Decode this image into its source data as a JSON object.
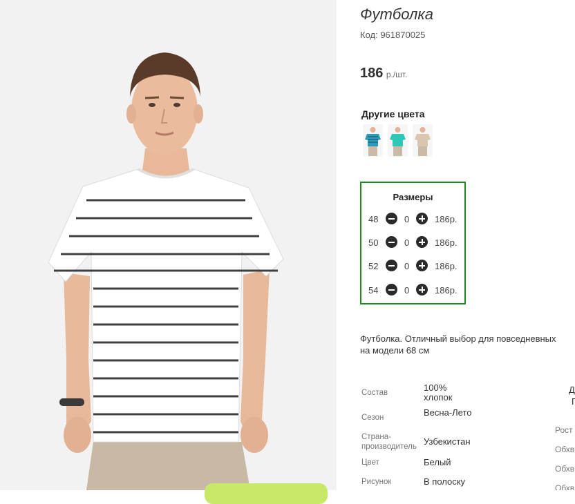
{
  "product": {
    "title": "Футболка",
    "code": "Код: 961870025",
    "price_value": "186",
    "price_unit": "р./шт."
  },
  "colors": {
    "heading": "Другие цвета",
    "items": [
      {
        "name": "blue-striped-thumb",
        "color": "#2a9bb8"
      },
      {
        "name": "turquoise-thumb",
        "color": "#2ec7b8"
      },
      {
        "name": "beige-thumb",
        "color": "#d8c6ae"
      }
    ]
  },
  "sizes": {
    "heading": "Размеры",
    "rows": [
      {
        "size": "48",
        "qty": "0",
        "price": "186р."
      },
      {
        "size": "50",
        "qty": "0",
        "price": "186р."
      },
      {
        "size": "52",
        "qty": "0",
        "price": "186р."
      },
      {
        "size": "54",
        "qty": "0",
        "price": "186р."
      }
    ]
  },
  "description": {
    "line1": "Футболка. Отличный выбор для повседневных",
    "line2": "на модели 68 см"
  },
  "properties": [
    {
      "label": "Состав",
      "value": "100% хлопок"
    },
    {
      "label": "Сезон",
      "value": "Весна-Лето"
    },
    {
      "label": "Страна-производитель",
      "value": "Узбекистан"
    },
    {
      "label": "Цвет",
      "value": "Белый"
    },
    {
      "label": "Рисунок",
      "value": "В полоску"
    }
  ],
  "properties_right": {
    "cut1": "Д",
    "cut2": "Г",
    "rost": "Рост",
    "obkhv1": "Обхв",
    "obkhv2": "Обхв",
    "obkhv3": "Обхв"
  },
  "colors_style": {
    "accent_border": "#1e8a1e",
    "cta": "#c8e86a"
  }
}
